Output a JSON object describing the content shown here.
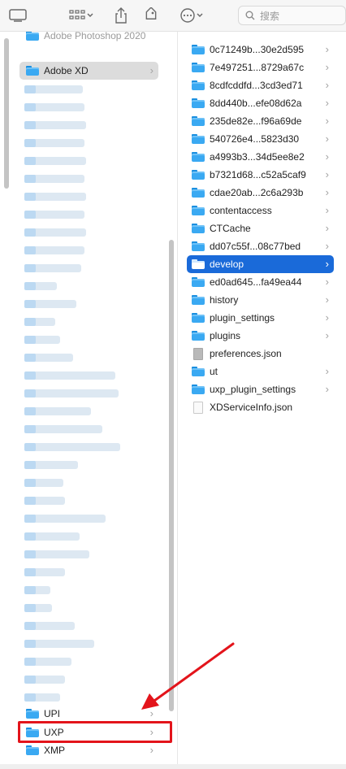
{
  "toolbar": {
    "icons": [
      "sidebar-icon",
      "view-grid-icon",
      "share-icon",
      "tag-icon",
      "more-actions-icon"
    ],
    "search_placeholder": "搜索"
  },
  "column1": {
    "partial_top_label": "Adobe Photoshop 2020",
    "selected_folder": "Adobe XD",
    "bottom_items": [
      "UPI",
      "UXP",
      "XMP"
    ],
    "highlighted_item": "UXP"
  },
  "column2": {
    "items": [
      {
        "name": "0c71249b...30e2d595",
        "kind": "folder"
      },
      {
        "name": "7e497251...8729a67c",
        "kind": "folder"
      },
      {
        "name": "8cdfcddfd...3cd3ed71",
        "kind": "folder"
      },
      {
        "name": "8dd440b...efe08d62a",
        "kind": "folder"
      },
      {
        "name": "235de82e...f96a69de",
        "kind": "folder"
      },
      {
        "name": "540726e4...5823d30",
        "kind": "folder"
      },
      {
        "name": "a4993b3...34d5ee8e2",
        "kind": "folder"
      },
      {
        "name": "b7321d68...c52a5caf9",
        "kind": "folder"
      },
      {
        "name": "cdae20ab...2c6a293b",
        "kind": "folder"
      },
      {
        "name": "contentaccess",
        "kind": "folder"
      },
      {
        "name": "CTCache",
        "kind": "folder"
      },
      {
        "name": "dd07c55f...08c77bed",
        "kind": "folder"
      },
      {
        "name": "develop",
        "kind": "folder",
        "selected": true
      },
      {
        "name": "ed0ad645...fa49ea44",
        "kind": "folder"
      },
      {
        "name": "history",
        "kind": "folder"
      },
      {
        "name": "plugin_settings",
        "kind": "folder"
      },
      {
        "name": "plugins",
        "kind": "folder"
      },
      {
        "name": "preferences.json",
        "kind": "file-gray"
      },
      {
        "name": "ut",
        "kind": "folder"
      },
      {
        "name": "uxp_plugin_settings",
        "kind": "folder"
      },
      {
        "name": "XDServiceInfo.json",
        "kind": "file"
      }
    ]
  },
  "colors": {
    "selection": "#1a6ad9",
    "annotation": "#e3141b",
    "folder": "#3aa9f2"
  }
}
